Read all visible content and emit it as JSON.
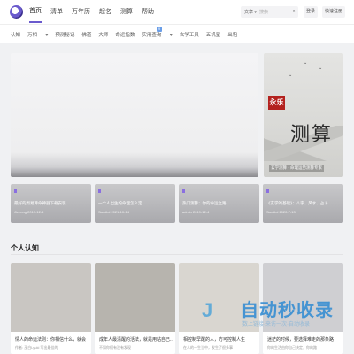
{
  "header": {
    "nav": [
      "首页",
      "清单",
      "万年历",
      "起名",
      "测算",
      "帮助"
    ],
    "search_select": "文章",
    "search_placeholder": "搜索",
    "login": "登录",
    "register": "快速注册"
  },
  "subnav": {
    "items": [
      "认知",
      "万相",
      "预测秘记",
      "佛道",
      "大师",
      "命运指数",
      "实用查询",
      "玄学工具",
      "五机星",
      "出租"
    ],
    "badge": "9"
  },
  "hero": {
    "stamp": "永乐",
    "title": "测算",
    "caption": "玄学测算 · 命理运势测算专家"
  },
  "cards": [
    {
      "title": "最好的周易算命神器下载安装",
      "meta": "Jiehong  2019-12-4"
    },
    {
      "title": "一个人出生的命理怎么定",
      "meta": "Sandiul  2021-10-14"
    },
    {
      "title": "热门测算：你的命运之路",
      "meta": "admin  2019-12-4"
    },
    {
      "title": "《玄学的基础》：八字、风水、占卜",
      "meta": "Sandiul  2020-7-13"
    }
  ],
  "section": {
    "title": "个人认知"
  },
  "articles": [
    {
      "title": "情人的命运法则：你相信什么，就会",
      "meta": "作者: 巫白Lyuki 写出最佳的",
      "color": "#c9c6c2"
    },
    {
      "title": "成年人最清醒的活法，就是用粘自己...",
      "meta": "不知你们有没有发现",
      "color": "#b7b4ae"
    },
    {
      "title": "相控制早醒的人，方可控制人生",
      "meta": "在人的一生当中，发生了很多事",
      "color": "#d9d6d0"
    },
    {
      "title": "迷茫的时候，要选择难走的那条路",
      "meta": "你的生活由你自己决定，你的路",
      "color": "#cfcfd2"
    }
  ],
  "watermark": {
    "main": "自动秒收录",
    "sub": "数上链接·来访一次·自动收录",
    "logo": "J"
  }
}
